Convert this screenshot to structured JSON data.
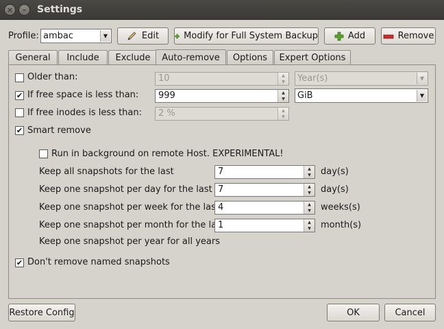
{
  "window": {
    "title": "Settings"
  },
  "profile": {
    "label": "Profile:",
    "value": "ambac",
    "edit_label": "Edit",
    "modify_label": "Modify for Full System Backup",
    "add_label": "Add",
    "remove_label": "Remove"
  },
  "tabs": [
    {
      "label": "General"
    },
    {
      "label": "Include"
    },
    {
      "label": "Exclude"
    },
    {
      "label": "Auto-remove"
    },
    {
      "label": "Options"
    },
    {
      "label": "Expert Options"
    }
  ],
  "autoremove": {
    "older_than": {
      "label": "Older than:",
      "checked": false,
      "value": "10",
      "unit": "Year(s)"
    },
    "free_space": {
      "label": "If free space is less than:",
      "checked": true,
      "value": "999",
      "unit": "GiB"
    },
    "free_inodes": {
      "label": "If free inodes is less than:",
      "checked": false,
      "value": "2 %"
    },
    "smart_remove": {
      "label": "Smart remove",
      "checked": true
    },
    "run_background": {
      "label": "Run in background on remote Host. EXPERIMENTAL!",
      "checked": false
    },
    "keep_all": {
      "label": "Keep all snapshots for the last",
      "value": "7",
      "unit": "day(s)"
    },
    "keep_day": {
      "label": "Keep one snapshot per day for the last",
      "value": "7",
      "unit": "day(s)"
    },
    "keep_week": {
      "label": "Keep one snapshot per week for the last",
      "value": "4",
      "unit": "weeks(s)"
    },
    "keep_month": {
      "label": "Keep one snapshot per month for the last",
      "value": "1",
      "unit": "month(s)"
    },
    "keep_year": {
      "label": "Keep one snapshot per year for all years"
    },
    "dont_remove_named": {
      "label": "Don't remove named snapshots",
      "checked": true
    }
  },
  "footer": {
    "restore_label": "Restore Config",
    "ok_label": "OK",
    "cancel_label": "Cancel"
  },
  "icons": {
    "close": "close-icon",
    "minimize": "minimize-icon",
    "edit": "pencil-icon",
    "modify": "plus-icon",
    "add": "plus-icon",
    "remove": "minus-icon"
  },
  "colors": {
    "add_green": "#5aa02c",
    "remove_red": "#cc2b2b"
  }
}
